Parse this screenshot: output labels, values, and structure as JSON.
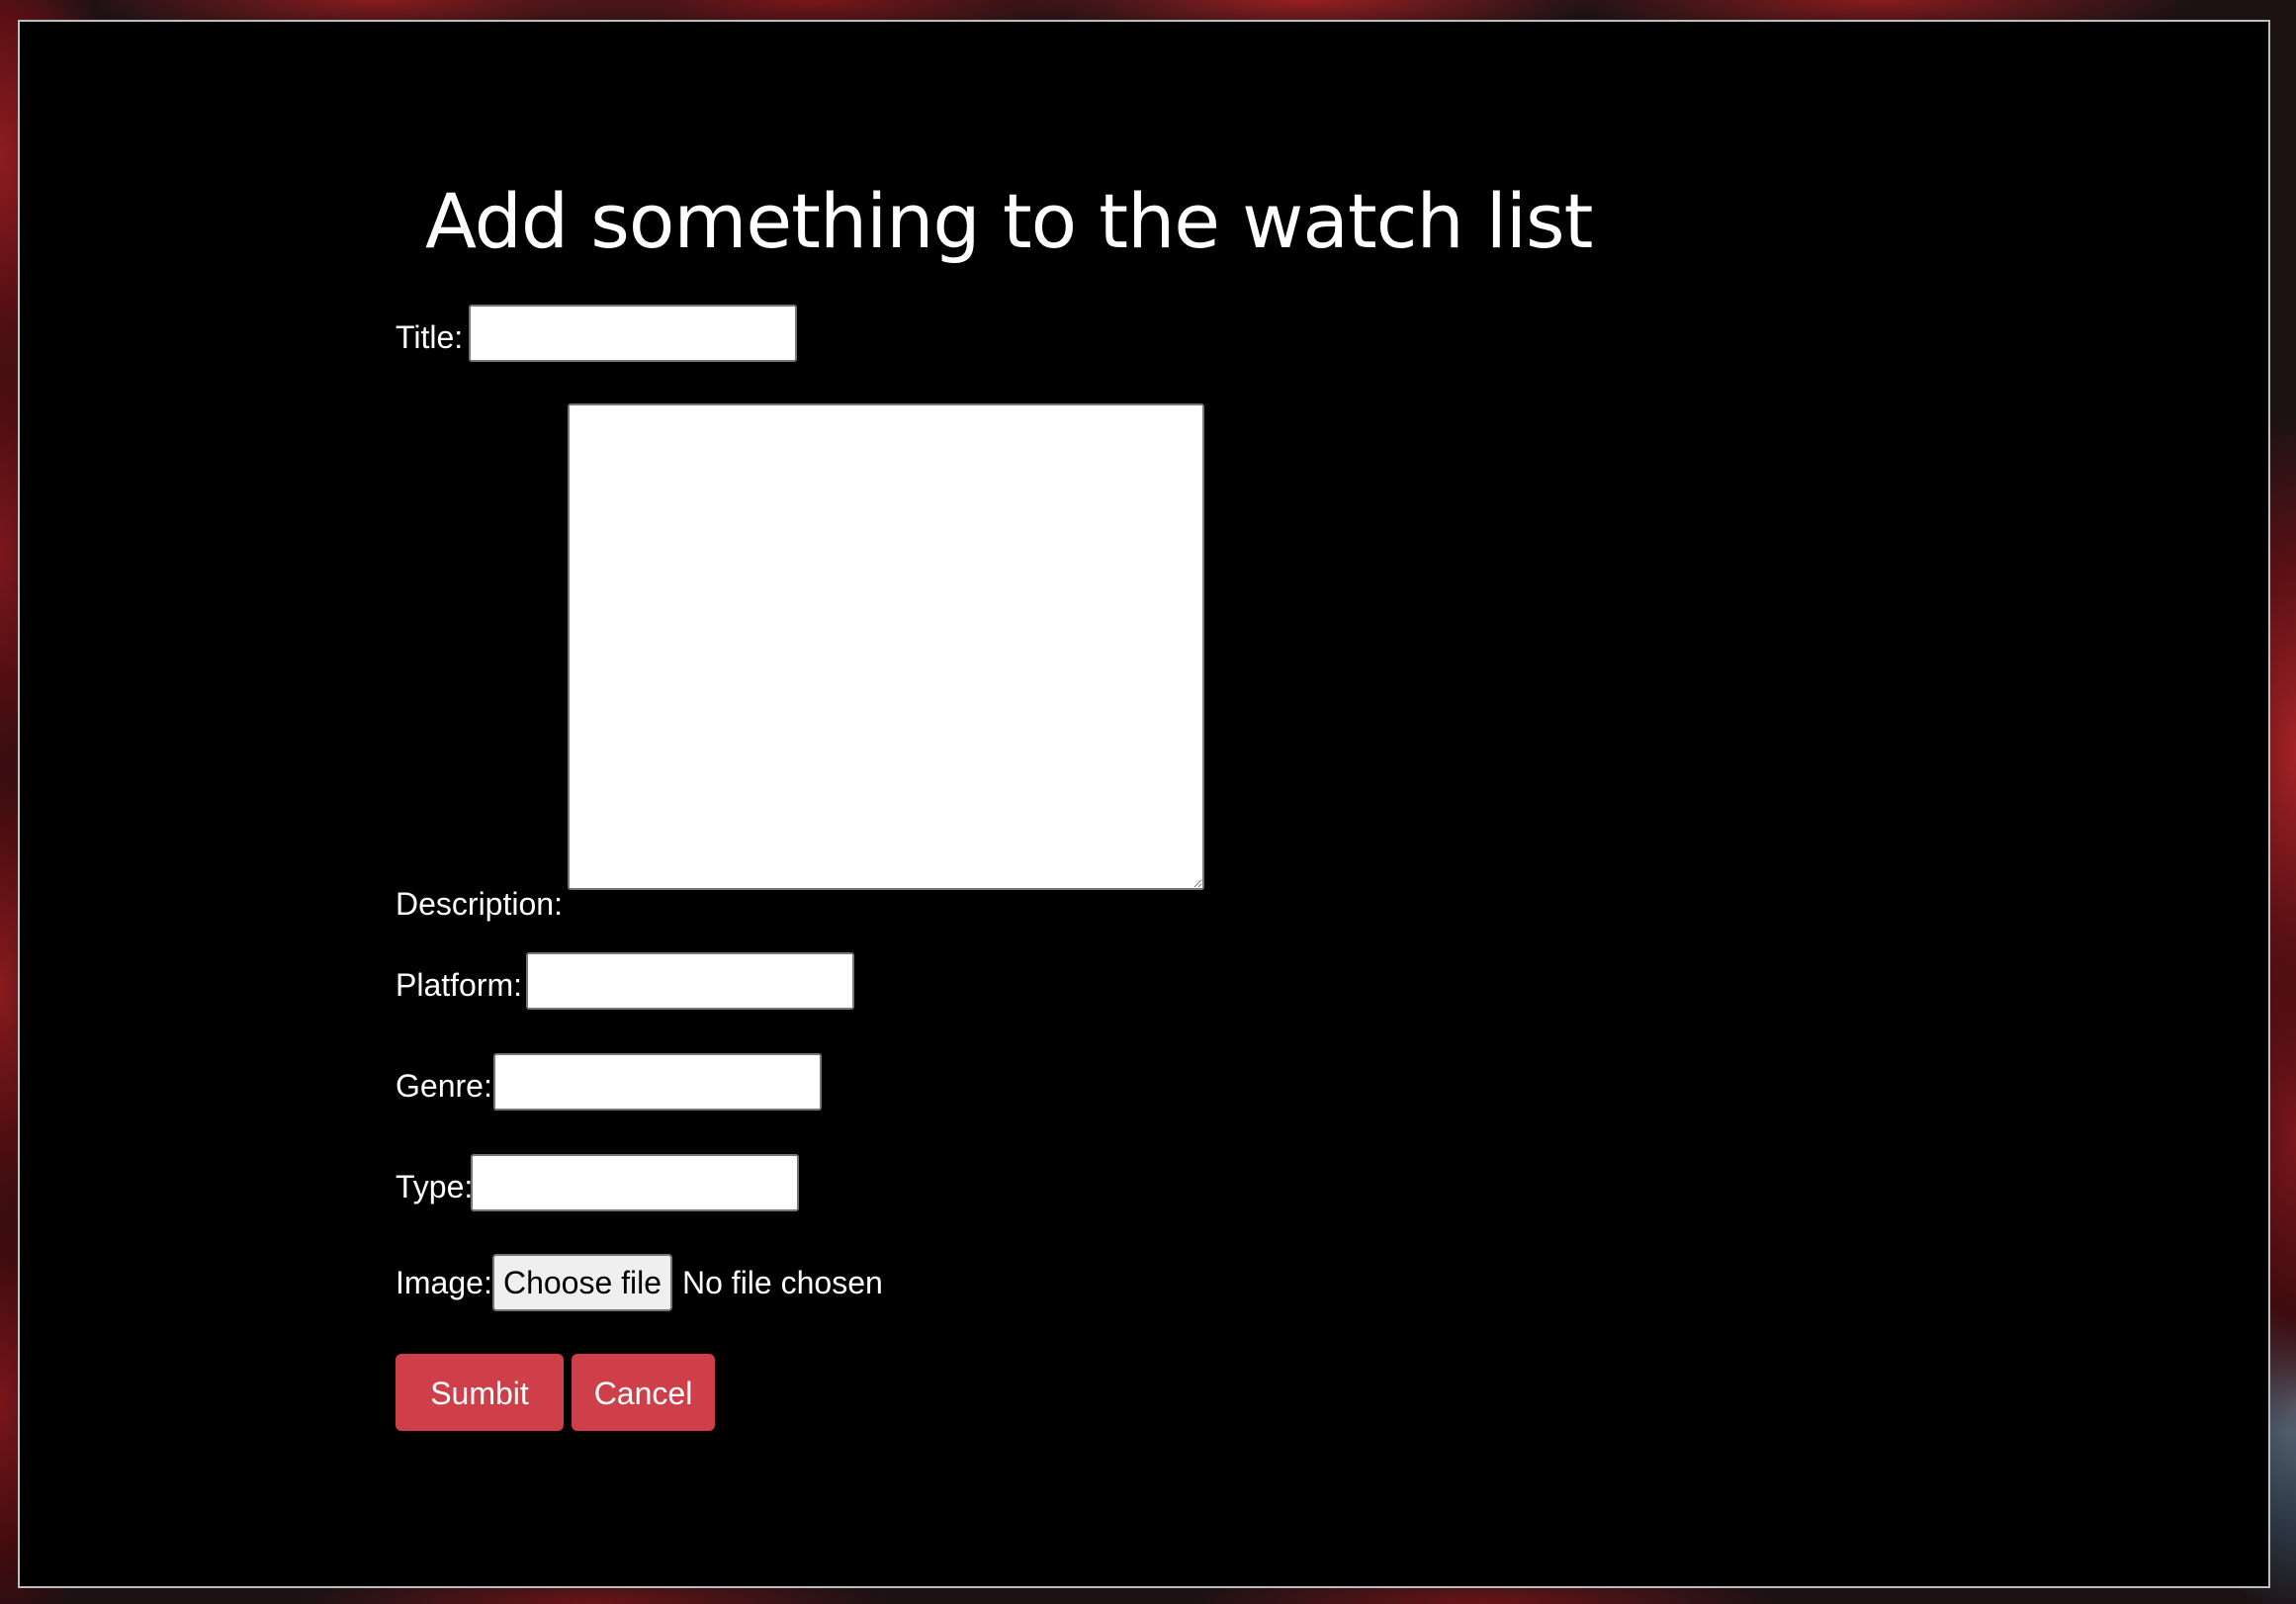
{
  "page": {
    "title": "Add something to the watch list"
  },
  "form": {
    "title": {
      "label": "Title:",
      "value": "",
      "placeholder": ""
    },
    "description": {
      "label": "Description:",
      "value": "",
      "placeholder": ""
    },
    "platform": {
      "label": "Platform:",
      "value": "",
      "placeholder": ""
    },
    "genre": {
      "label": "Genre:",
      "value": "",
      "placeholder": ""
    },
    "type": {
      "label": "Type:",
      "value": "",
      "placeholder": ""
    },
    "image": {
      "label": "Image:",
      "choose_button_label": "Choose file",
      "status_text": "No file chosen"
    }
  },
  "actions": {
    "submit_label": "Sumbit",
    "cancel_label": "Cancel"
  },
  "colors": {
    "panel_background": "#000000",
    "panel_border": "#bdbdbd",
    "button_accent": "#cf3f49",
    "text": "#ffffff",
    "backdrop_seats": "#8e1c1f"
  }
}
